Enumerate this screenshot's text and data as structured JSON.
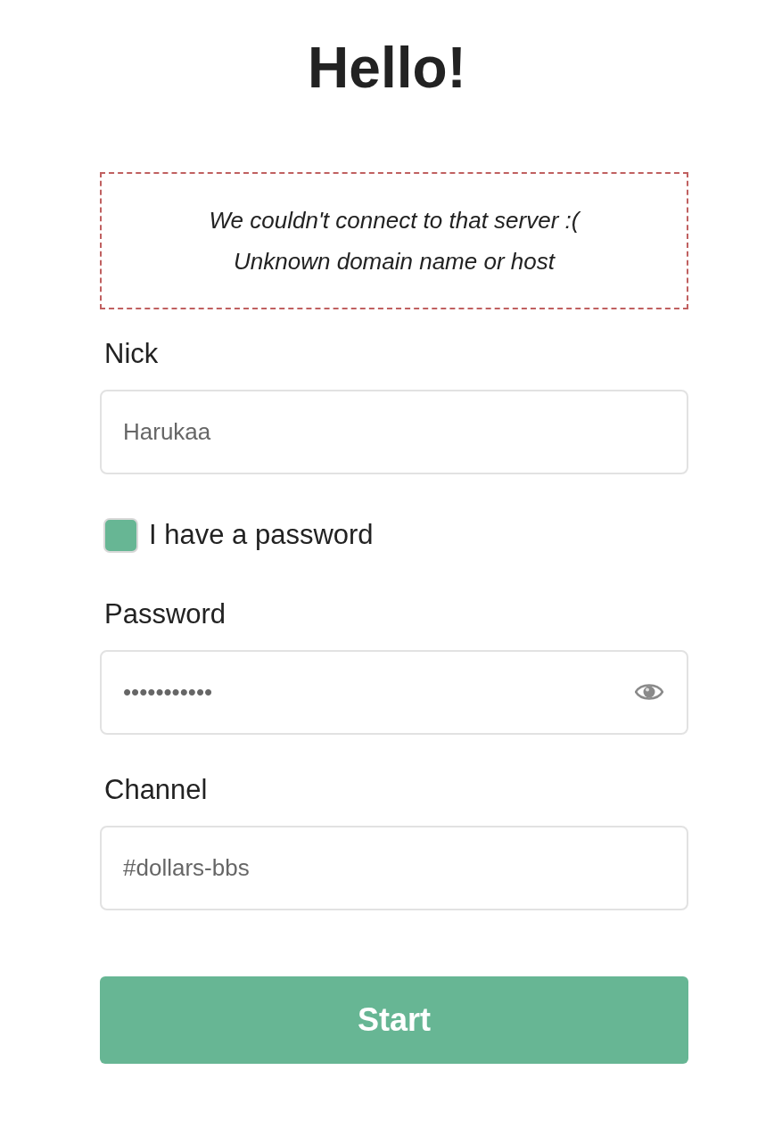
{
  "title": "Hello!",
  "error": {
    "lines": [
      "We couldn't connect to that server :(",
      "Unknown domain name or host"
    ]
  },
  "nick": {
    "label": "Nick",
    "value": "Harukaa"
  },
  "has_password": {
    "label": "I have a password",
    "checked": true
  },
  "password": {
    "label": "Password",
    "value": "•••••••••••"
  },
  "channel": {
    "label": "Channel",
    "value": "#dollars-bbs"
  },
  "submit": {
    "label": "Start"
  }
}
